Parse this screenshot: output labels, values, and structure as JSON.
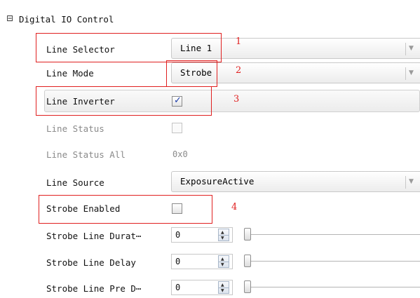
{
  "section": {
    "title": "Digital IO Control",
    "expander_symbol": "⊟"
  },
  "rows": {
    "line_selector": {
      "label": "Line Selector",
      "value": "Line 1",
      "annotation": "1"
    },
    "line_mode": {
      "label": "Line Mode",
      "value": "Strobe",
      "annotation": "2"
    },
    "line_inverter": {
      "label": "Line Inverter",
      "checked": true,
      "annotation": "3"
    },
    "line_status": {
      "label": "Line Status",
      "checked": false
    },
    "line_status_all": {
      "label": "Line Status All",
      "value": "0x0"
    },
    "line_source": {
      "label": "Line Source",
      "value": "ExposureActive"
    },
    "strobe_enabled": {
      "label": "Strobe Enabled",
      "checked": false,
      "annotation": "4"
    },
    "strobe_line_duration": {
      "label": "Strobe Line Durat⋯",
      "value": "0",
      "slider_fraction": 0
    },
    "strobe_line_delay": {
      "label": "Strobe Line Delay",
      "value": "0",
      "slider_fraction": 0
    },
    "strobe_line_pre_delay": {
      "label": "Strobe Line Pre D⋯",
      "value": "0",
      "slider_fraction": 0
    }
  },
  "glyphs": {
    "check": "✓",
    "arrow_down": "▼",
    "spin_up": "▲",
    "spin_down": "▼"
  },
  "colors": {
    "annotation_red": "#e02020",
    "check_blue": "#1a3aa8"
  }
}
